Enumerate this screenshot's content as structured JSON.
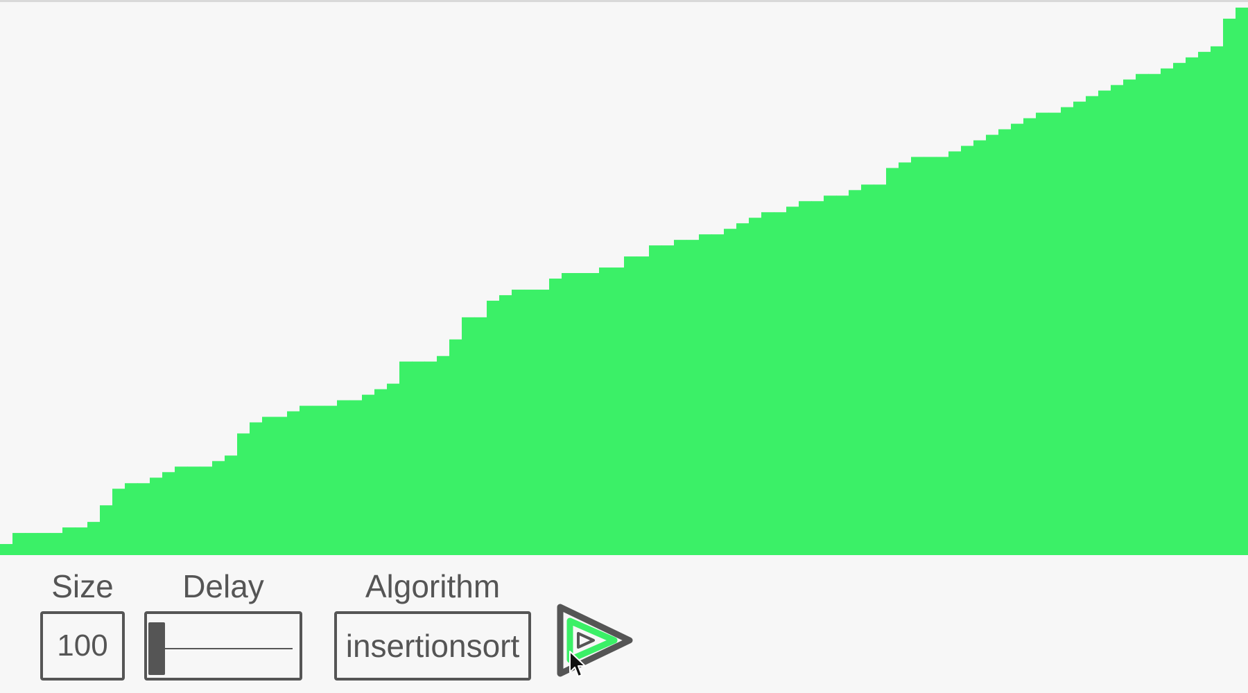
{
  "colors": {
    "bar": "#3bf067",
    "background": "#f7f7f7",
    "control": "#555555"
  },
  "chart_data": {
    "type": "bar",
    "title": "",
    "xlabel": "",
    "ylabel": "",
    "ylim": [
      0,
      100
    ],
    "values": [
      2,
      4,
      4,
      4,
      4,
      5,
      5,
      6,
      9,
      12,
      13,
      13,
      14,
      15,
      16,
      16,
      16,
      17,
      18,
      22,
      24,
      25,
      25,
      26,
      27,
      27,
      27,
      28,
      28,
      29,
      30,
      31,
      35,
      35,
      35,
      36,
      39,
      43,
      43,
      46,
      47,
      48,
      48,
      48,
      50,
      51,
      51,
      51,
      52,
      52,
      54,
      54,
      56,
      56,
      57,
      57,
      58,
      58,
      59,
      60,
      61,
      62,
      62,
      63,
      64,
      64,
      65,
      65,
      66,
      67,
      67,
      70,
      71,
      72,
      72,
      72,
      73,
      74,
      75,
      76,
      77,
      78,
      79,
      80,
      80,
      81,
      82,
      83,
      84,
      85,
      86,
      87,
      87,
      88,
      89,
      90,
      91,
      92,
      97,
      99
    ]
  },
  "controls": {
    "size_label": "Size",
    "size_value": "100",
    "delay_label": "Delay",
    "delay_value": 0,
    "algorithm_label": "Algorithm",
    "algorithm_value": "insertionsort"
  },
  "icons": {
    "play": "play-icon",
    "cursor": "mouse-cursor-icon"
  }
}
